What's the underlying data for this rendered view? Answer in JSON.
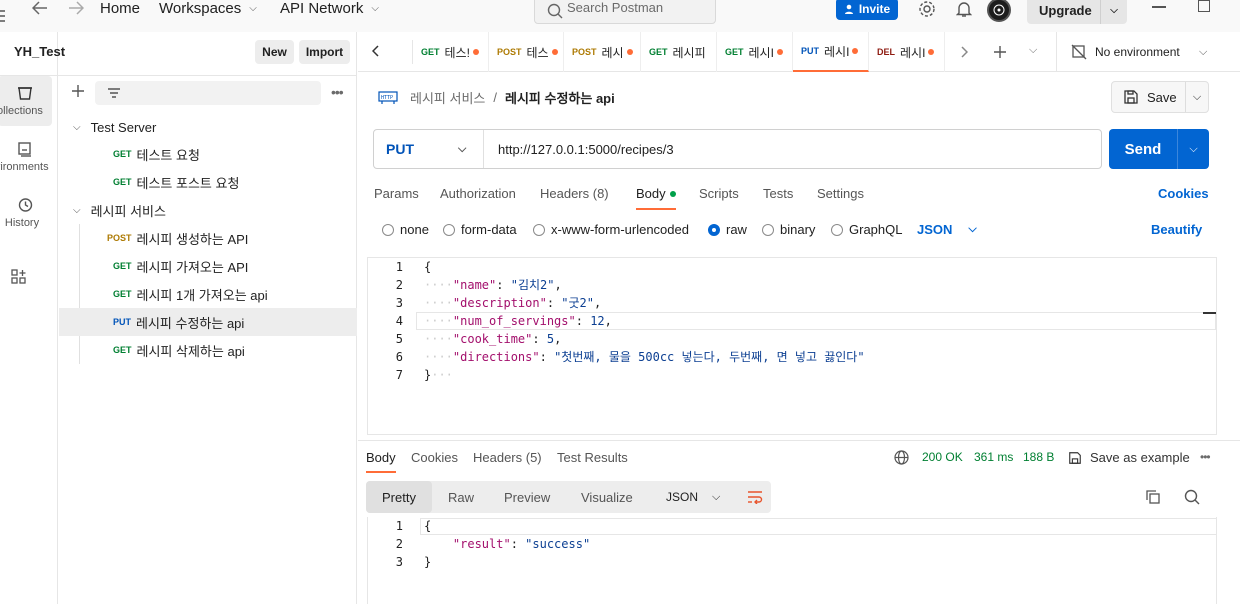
{
  "topbar": {
    "home": "Home",
    "workspaces": "Workspaces",
    "api_network": "API Network",
    "search_placeholder": "Search Postman",
    "invite": "Invite",
    "upgrade": "Upgrade"
  },
  "workspace": {
    "name": "YH_Test",
    "new_label": "New",
    "import_label": "Import"
  },
  "rail": [
    {
      "label": "Collections",
      "icon": "collections-icon"
    },
    {
      "label": "Environments",
      "icon": "environments-icon"
    },
    {
      "label": "History",
      "icon": "history-icon"
    },
    {
      "label": "",
      "icon": "apps-icon"
    }
  ],
  "tree": {
    "collections": [
      {
        "name": "Test Server",
        "items": [
          {
            "method": "GET",
            "name": "테스트 요청"
          },
          {
            "method": "GET",
            "name": "테스트 포스트 요청"
          }
        ]
      },
      {
        "name": "레시피 서비스",
        "items": [
          {
            "method": "POST",
            "name": "레시피 생성하는 API"
          },
          {
            "method": "GET",
            "name": "레시피 가져오는 API"
          },
          {
            "method": "GET",
            "name": "레시피 1개 가져오는 api"
          },
          {
            "method": "PUT",
            "name": "레시피 수정하는 api",
            "selected": true
          },
          {
            "method": "GET",
            "name": "레시피 삭제하는 api"
          }
        ]
      }
    ]
  },
  "tabs": [
    {
      "method": "GET",
      "name": "테스!"
    },
    {
      "method": "POST",
      "name": "테스"
    },
    {
      "method": "POST",
      "name": "레시"
    },
    {
      "method": "GET",
      "name": "레시피"
    },
    {
      "method": "GET",
      "name": "레시I"
    },
    {
      "method": "PUT",
      "name": "레시I"
    },
    {
      "method": "DEL",
      "name": "레시I"
    }
  ],
  "environment": "No environment",
  "breadcrumb": {
    "collection": "레시피 서비스",
    "separator": "/",
    "request": "레시피 수정하는 api"
  },
  "save_label": "Save",
  "request": {
    "method": "PUT",
    "url": "http://127.0.0.1:5000/recipes/3",
    "send_label": "Send",
    "tabs": [
      "Params",
      "Authorization",
      "Headers (8)",
      "Body",
      "Scripts",
      "Tests",
      "Settings"
    ],
    "cookies_label": "Cookies",
    "body_types": [
      "none",
      "form-data",
      "x-www-form-urlencoded",
      "raw",
      "binary",
      "GraphQL"
    ],
    "body_format": "JSON",
    "beautify_label": "Beautify",
    "body_lines": [
      {
        "n": "1",
        "indent": false,
        "key": "",
        "val": "",
        "text": "{"
      },
      {
        "n": "2",
        "indent": true,
        "key": "\"name\"",
        "val": "\"김치2\"",
        "text": ","
      },
      {
        "n": "3",
        "indent": true,
        "key": "\"description\"",
        "val": "\"굿2\"",
        "text": ","
      },
      {
        "n": "4",
        "indent": true,
        "key": "\"num_of_servings\"",
        "val": "12",
        "text": ","
      },
      {
        "n": "5",
        "indent": true,
        "key": "\"cook_time\"",
        "val": "5",
        "text": ","
      },
      {
        "n": "6",
        "indent": true,
        "key": "\"directions\"",
        "val": "\"첫번째, 물을 500cc 넣는다, 두번째, 면 넣고 끓인다\"",
        "text": ""
      },
      {
        "n": "7",
        "indent": false,
        "key": "",
        "val": "",
        "text": "}"
      }
    ]
  },
  "response": {
    "tabs": [
      "Body",
      "Cookies",
      "Headers (5)",
      "Test Results"
    ],
    "status": "200 OK",
    "time": "361 ms",
    "size": "188 B",
    "save_example": "Save as example",
    "view_modes": [
      "Pretty",
      "Raw",
      "Preview",
      "Visualize"
    ],
    "format": "JSON",
    "lines": [
      {
        "n": "1",
        "text": "{"
      },
      {
        "n": "2",
        "key": "\"result\"",
        "val": "\"success\""
      },
      {
        "n": "3",
        "text": "}"
      }
    ]
  },
  "colors": {
    "accent": "#ff6c37",
    "primary": "#0265d2",
    "get": "#007f31",
    "post": "#ad7a03",
    "put": "#0053b8",
    "del": "#8e1a10",
    "status_ok": "#007f31"
  }
}
